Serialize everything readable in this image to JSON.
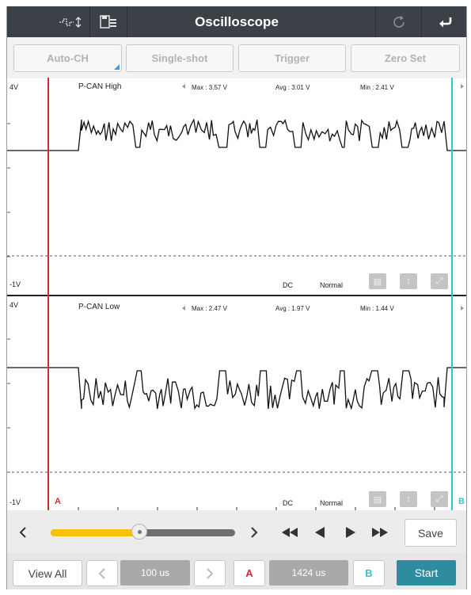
{
  "header": {
    "title": "Oscilloscope",
    "icons": [
      "waveform-sync-icon",
      "save-file-icon",
      "refresh-icon",
      "return-icon"
    ]
  },
  "toolbar": {
    "auto_ch": "Auto-CH",
    "single_shot": "Single-shot",
    "trigger": "Trigger",
    "zero_set": "Zero Set"
  },
  "channels": [
    {
      "name": "P-CAN High",
      "y_max_label": "4V",
      "y_min_label": "-1V",
      "max": "Max : 3.57 V",
      "avg": "Avg : 3.01 V",
      "min": "Min : 2.41 V",
      "coupling": "DC",
      "mode": "Normal"
    },
    {
      "name": "P-CAN Low",
      "y_max_label": "4V",
      "y_min_label": "-1V",
      "max": "Max : 2.47 V",
      "avg": "Avg : 1.97 V",
      "min": "Min : 1.44 V",
      "coupling": "DC",
      "mode": "Normal"
    }
  ],
  "cursors": {
    "a_label": "A",
    "b_label": "B",
    "a_color": "#e0242e",
    "b_color": "#35c4cc"
  },
  "scroll": {
    "position": 0.48,
    "save": "Save",
    "track_color": "#f5c10f"
  },
  "bottom": {
    "view_all": "View All",
    "timebase": "100 us",
    "cursor_a": "A",
    "cursor_delta": "1424 us",
    "cursor_b": "B",
    "start": "Start",
    "start_color": "#2e8c9e"
  }
}
